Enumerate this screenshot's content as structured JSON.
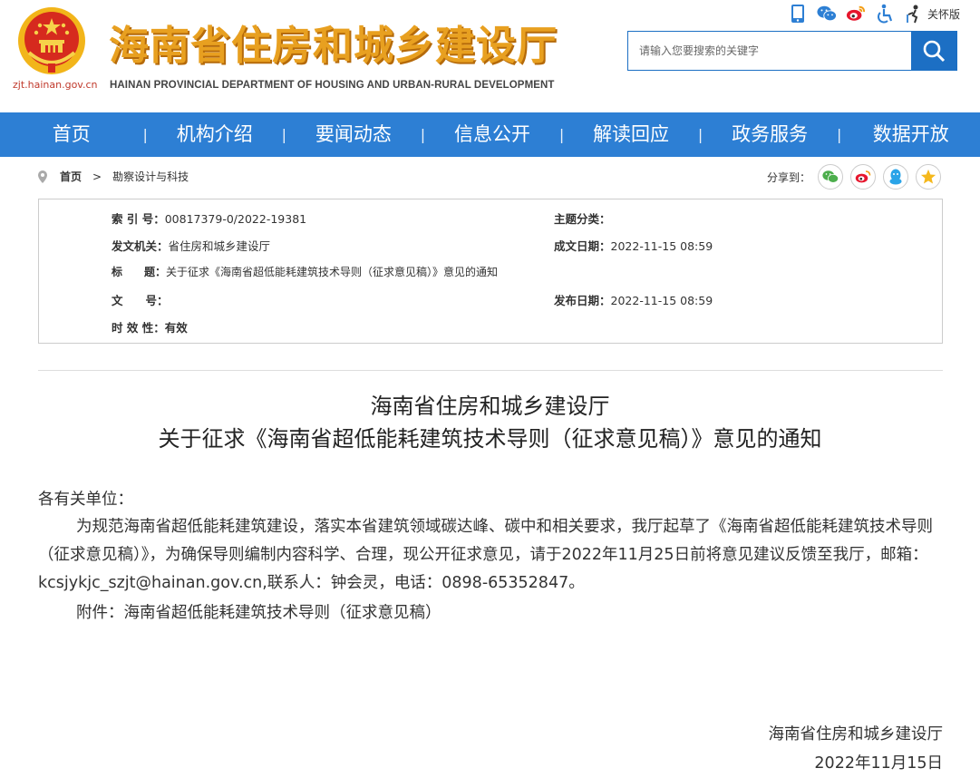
{
  "header": {
    "site_url": "zjt.hainan.gov.cn",
    "title": "海南省住房和城乡建设厅",
    "subtitle": "HAINAN PROVINCIAL DEPARTMENT OF HOUSING AND URBAN-RURAL DEVELOPMENT",
    "care_mode_label": "关怀版",
    "tools": [
      "mobile-icon",
      "wechat-icon",
      "weibo-icon",
      "accessibility-icon",
      "care-mode-icon"
    ]
  },
  "search": {
    "placeholder": "请输入您要搜索的关键字"
  },
  "nav": {
    "items": [
      "首页",
      "机构介绍",
      "要闻动态",
      "信息公开",
      "解读回应",
      "政务服务",
      "数据开放"
    ]
  },
  "breadcrumb": {
    "home": "首页",
    "separator": ">",
    "current": "勘察设计与科技"
  },
  "share": {
    "label": "分享到：",
    "targets": [
      "wechat-icon",
      "weibo-icon",
      "qq-icon",
      "qzone-icon"
    ]
  },
  "info": {
    "index_key": "索 引 号：",
    "index_val": "00817379-0/2022-19381",
    "category_key": "主题分类：",
    "category_val": "",
    "issuer_key": "发文机关：",
    "issuer_val": "省住房和城乡建设厅",
    "created_key": "成文日期：",
    "created_val": "2022-11-15 08:59",
    "title_key": "标　　题：",
    "title_val": "关于征求《海南省超低能耗建筑技术导则（征求意见稿）》意见的通知",
    "docno_key": "文　　号：",
    "docno_val": "",
    "published_key": "发布日期：",
    "published_val": "2022-11-15 08:59",
    "validity_key": "时 效 性：",
    "validity_val": "有效"
  },
  "document": {
    "org": "海南省住房和城乡建设厅",
    "title": "关于征求《海南省超低能耗建筑技术导则（征求意见稿）》意见的通知",
    "salutation": "各有关单位：",
    "paragraph": "为规范海南省超低能耗建筑建设，落实本省建筑领域碳达峰、碳中和相关要求，我厅起草了《海南省超低能耗建筑技术导则（征求意见稿）》，为确保导则编制内容科学、合理，现公开征求意见，请于2022年11月25日前将意见建议反馈至我厅，邮箱：kcsjykjc_szjt@hainan.gov.cn,联系人：钟会灵，电话：0898-65352847。",
    "attachment": "附件：海南省超低能耗建筑技术导则（征求意见稿）",
    "sign_org": "海南省住房和城乡建设厅",
    "sign_date": "2022年11月15日"
  },
  "colors": {
    "nav_bg": "#2d7fd4",
    "title_gold": "#e8a020",
    "search_blue": "#1c6fc4"
  }
}
